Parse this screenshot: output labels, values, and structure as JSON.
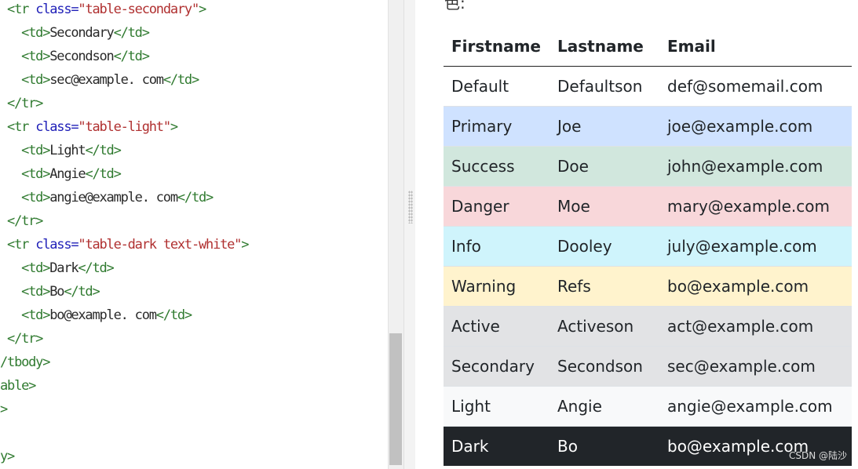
{
  "editor": {
    "lines": [
      {
        "indent": " ",
        "tokens": [
          {
            "t": "<tr ",
            "k": "tag"
          },
          {
            "t": "class=",
            "k": "attr"
          },
          {
            "t": "\"table-secondary\"",
            "k": "val"
          },
          {
            "t": ">",
            "k": "tag"
          }
        ]
      },
      {
        "indent": "   ",
        "tokens": [
          {
            "t": "<td>",
            "k": "tag"
          },
          {
            "t": "Secondary",
            "k": "text"
          },
          {
            "t": "</td>",
            "k": "tag"
          }
        ]
      },
      {
        "indent": "   ",
        "tokens": [
          {
            "t": "<td>",
            "k": "tag"
          },
          {
            "t": "Secondson",
            "k": "text"
          },
          {
            "t": "</td>",
            "k": "tag"
          }
        ]
      },
      {
        "indent": "   ",
        "tokens": [
          {
            "t": "<td>",
            "k": "tag"
          },
          {
            "t": "sec@example. com",
            "k": "text"
          },
          {
            "t": "</td>",
            "k": "tag"
          }
        ]
      },
      {
        "indent": " ",
        "tokens": [
          {
            "t": "</tr>",
            "k": "tag"
          }
        ]
      },
      {
        "indent": " ",
        "tokens": [
          {
            "t": "<tr ",
            "k": "tag"
          },
          {
            "t": "class=",
            "k": "attr"
          },
          {
            "t": "\"table-light\"",
            "k": "val"
          },
          {
            "t": ">",
            "k": "tag"
          }
        ]
      },
      {
        "indent": "   ",
        "tokens": [
          {
            "t": "<td>",
            "k": "tag"
          },
          {
            "t": "Light",
            "k": "text"
          },
          {
            "t": "</td>",
            "k": "tag"
          }
        ]
      },
      {
        "indent": "   ",
        "tokens": [
          {
            "t": "<td>",
            "k": "tag"
          },
          {
            "t": "Angie",
            "k": "text"
          },
          {
            "t": "</td>",
            "k": "tag"
          }
        ]
      },
      {
        "indent": "   ",
        "tokens": [
          {
            "t": "<td>",
            "k": "tag"
          },
          {
            "t": "angie@example. com",
            "k": "text"
          },
          {
            "t": "</td>",
            "k": "tag"
          }
        ]
      },
      {
        "indent": " ",
        "tokens": [
          {
            "t": "</tr>",
            "k": "tag"
          }
        ]
      },
      {
        "indent": " ",
        "tokens": [
          {
            "t": "<tr ",
            "k": "tag"
          },
          {
            "t": "class=",
            "k": "attr"
          },
          {
            "t": "\"table-dark text-white\"",
            "k": "val"
          },
          {
            "t": ">",
            "k": "tag"
          }
        ]
      },
      {
        "indent": "   ",
        "tokens": [
          {
            "t": "<td>",
            "k": "tag"
          },
          {
            "t": "Dark",
            "k": "text"
          },
          {
            "t": "</td>",
            "k": "tag"
          }
        ]
      },
      {
        "indent": "   ",
        "tokens": [
          {
            "t": "<td>",
            "k": "tag"
          },
          {
            "t": "Bo",
            "k": "text"
          },
          {
            "t": "</td>",
            "k": "tag"
          }
        ]
      },
      {
        "indent": "   ",
        "tokens": [
          {
            "t": "<td>",
            "k": "tag"
          },
          {
            "t": "bo@example. com",
            "k": "text"
          },
          {
            "t": "</td>",
            "k": "tag"
          }
        ]
      },
      {
        "indent": " ",
        "tokens": [
          {
            "t": "</tr>",
            "k": "tag"
          }
        ]
      },
      {
        "indent": "",
        "tokens": [
          {
            "t": "/tbody>",
            "k": "tag"
          }
        ]
      },
      {
        "indent": "",
        "tokens": [
          {
            "t": "able>",
            "k": "tag"
          }
        ]
      },
      {
        "indent": "",
        "tokens": [
          {
            "t": ">",
            "k": "tag"
          }
        ]
      },
      {
        "indent": "",
        "tokens": []
      },
      {
        "indent": "",
        "tokens": [
          {
            "t": "y>",
            "k": "tag"
          }
        ]
      }
    ],
    "token_colors": {
      "tag": "#2f7a2f",
      "attr": "#2020b8",
      "val": "#b03030",
      "text": "#2a2a2a"
    }
  },
  "preview": {
    "cut_text": "色:",
    "table": {
      "headers": [
        "Firstname",
        "Lastname",
        "Email"
      ],
      "rows": [
        {
          "variant": "default",
          "bg": "#ffffff",
          "fg": "#212529",
          "cells": [
            "Default",
            "Defaultson",
            "def@somemail.com"
          ]
        },
        {
          "variant": "primary",
          "bg": "#cfe2ff",
          "fg": "#212529",
          "cells": [
            "Primary",
            "Joe",
            "joe@example.com"
          ]
        },
        {
          "variant": "success",
          "bg": "#d1e7dd",
          "fg": "#212529",
          "cells": [
            "Success",
            "Doe",
            "john@example.com"
          ]
        },
        {
          "variant": "danger",
          "bg": "#f8d7da",
          "fg": "#212529",
          "cells": [
            "Danger",
            "Moe",
            "mary@example.com"
          ]
        },
        {
          "variant": "info",
          "bg": "#cff4fc",
          "fg": "#212529",
          "cells": [
            "Info",
            "Dooley",
            "july@example.com"
          ]
        },
        {
          "variant": "warning",
          "bg": "#fff3cd",
          "fg": "#212529",
          "cells": [
            "Warning",
            "Refs",
            "bo@example.com"
          ]
        },
        {
          "variant": "active",
          "bg": "#e2e3e5",
          "fg": "#212529",
          "cells": [
            "Active",
            "Activeson",
            "act@example.com"
          ]
        },
        {
          "variant": "secondary",
          "bg": "#e2e3e5",
          "fg": "#212529",
          "cells": [
            "Secondary",
            "Secondson",
            "sec@example.com"
          ]
        },
        {
          "variant": "light",
          "bg": "#f8f9fa",
          "fg": "#212529",
          "cells": [
            "Light",
            "Angie",
            "angie@example.com"
          ]
        },
        {
          "variant": "dark",
          "bg": "#212529",
          "fg": "#ffffff",
          "cells": [
            "Dark",
            "Bo",
            "bo@example.com"
          ]
        }
      ]
    }
  },
  "watermark": "CSDN @陆沙"
}
